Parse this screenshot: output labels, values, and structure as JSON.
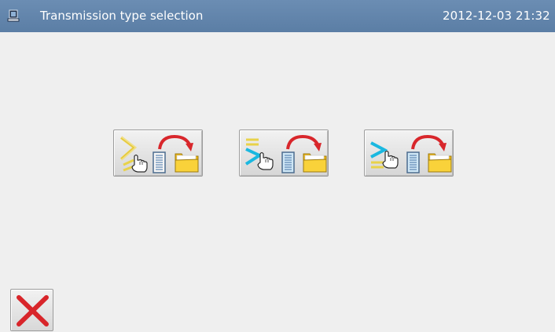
{
  "titlebar": {
    "icon": "computer-icon",
    "title": "Transmission type selection",
    "datetime": "2012-12-03  21:32"
  },
  "buttons": [
    {
      "name": "transmission-type-1-button",
      "icons": [
        "chevron-stitch-icon",
        "hand-pointer-icon",
        "document-icon",
        "transfer-arrow-icon",
        "folder-icon"
      ],
      "accent": "#e8d24a"
    },
    {
      "name": "transmission-type-2-button",
      "icons": [
        "chevron-stitch-icon",
        "hand-pointer-icon",
        "document-icon",
        "transfer-arrow-icon",
        "folder-icon"
      ],
      "accent": "#1ab8e0"
    },
    {
      "name": "transmission-type-3-button",
      "icons": [
        "chevron-stitch-icon",
        "hand-pointer-icon",
        "document-icon",
        "transfer-arrow-icon",
        "folder-icon"
      ],
      "accent": "#1ab8e0"
    }
  ],
  "cancel": {
    "icon": "close-icon",
    "color": "#d8252a"
  },
  "colors": {
    "titlebar": "#5f82a9",
    "background": "#efefef",
    "arrow": "#d8262b",
    "folder": "#f5c21b",
    "document": "#cfe7f6"
  }
}
